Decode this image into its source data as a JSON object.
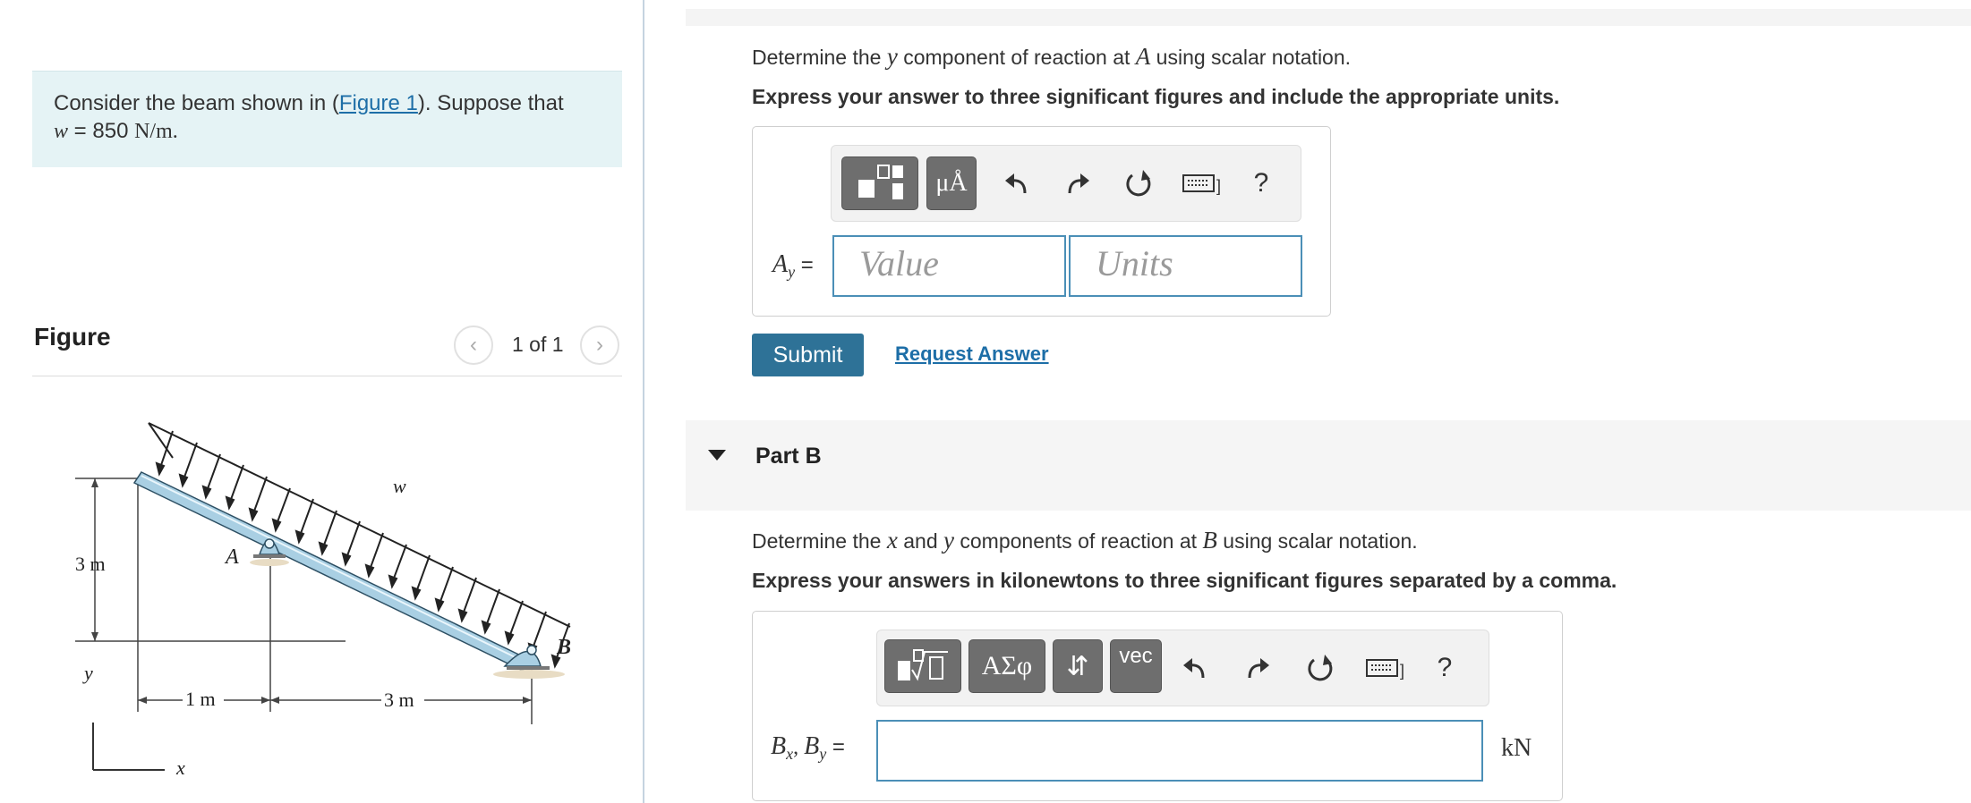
{
  "problem": {
    "text_before": "Consider the beam shown in (",
    "link": "Figure 1",
    "text_after": "). Suppose that",
    "w_label": "w",
    "w_value": " = 850 ",
    "w_units": "N/m."
  },
  "figure_panel": {
    "title": "Figure",
    "pager": "1 of 1",
    "prev_icon": "chevron-left",
    "next_icon": "chevron-right",
    "diagram": {
      "label_w": "w",
      "label_A": "A",
      "label_B": "B",
      "label_3m_vert": "3 m",
      "label_y": "y",
      "label_x": "x",
      "label_1m": "1 m",
      "label_3m_horiz": "3 m"
    }
  },
  "part_a": {
    "question_pre": "Determine the ",
    "question_var": "y",
    "question_mid": " component of reaction at ",
    "question_point": "A",
    "question_post": "  using scalar notation.",
    "instruction": "Express your answer to three significant figures and include the appropriate units.",
    "toolbar": {
      "units_btn": "μÅ",
      "icons": [
        "templates-icon",
        "units-icon",
        "undo-icon",
        "redo-icon",
        "reset-icon",
        "keyboard-icon",
        "help-icon"
      ],
      "help": "?"
    },
    "answer_label": "A",
    "answer_sub": "y",
    "answer_eq": " =",
    "value_placeholder": "Value",
    "units_placeholder": "Units",
    "submit": "Submit",
    "request": "Request Answer"
  },
  "part_b": {
    "title": "Part B",
    "question_pre": "Determine the ",
    "question_var1": "x",
    "question_and": " and ",
    "question_var2": "y",
    "question_mid": " components of reaction at ",
    "question_point": "B",
    "question_post": " using scalar notation.",
    "instruction": "Express your answers in kilonewtons to three significant figures separated by a comma.",
    "toolbar": {
      "greek_btn": "ΑΣφ",
      "arrows_btn": "⇵",
      "vec_btn": "vec",
      "help": "?"
    },
    "answer_label1": "B",
    "answer_sub1": "x",
    "answer_label2": "B",
    "answer_sub2": "y",
    "answer_eq": " =",
    "unit": "kN"
  }
}
